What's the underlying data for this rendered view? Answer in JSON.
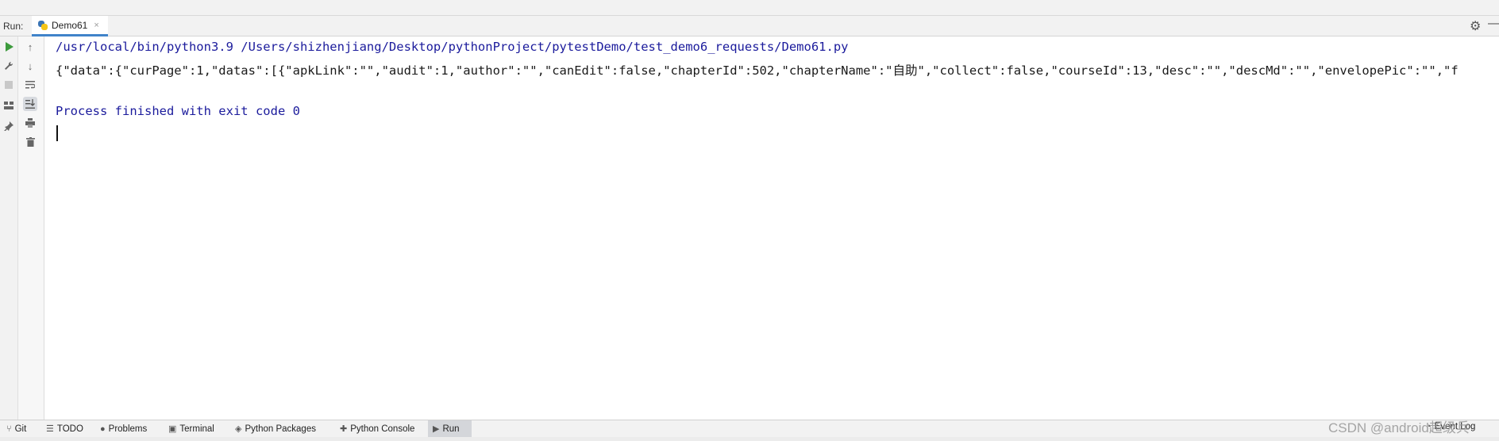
{
  "run_bar": {
    "label": "Run:",
    "tab_name": "Demo61",
    "tab_close": "×"
  },
  "console": {
    "command_line": "/usr/local/bin/python3.9 /Users/shizhenjiang/Desktop/pythonProject/pytestDemo/test_demo6_requests/Demo61.py",
    "output_line": "{\"data\":{\"curPage\":1,\"datas\":[{\"apkLink\":\"\",\"audit\":1,\"author\":\"\",\"canEdit\":false,\"chapterId\":502,\"chapterName\":\"自助\",\"collect\":false,\"courseId\":13,\"desc\":\"\",\"descMd\":\"\",\"envelopePic\":\"\",\"f",
    "finished_line": "Process finished with exit code 0"
  },
  "bottom_tabs": [
    {
      "label": "Git",
      "icon": "git-branch-icon"
    },
    {
      "label": "TODO",
      "icon": "list-icon"
    },
    {
      "label": "Problems",
      "icon": "problems-icon"
    },
    {
      "label": "Terminal",
      "icon": "terminal-icon"
    },
    {
      "label": "Python Packages",
      "icon": "packages-icon"
    },
    {
      "label": "Python Console",
      "icon": "python-console-icon"
    },
    {
      "label": "Run",
      "icon": "run-icon"
    }
  ],
  "status": {
    "event_log": "Event Log",
    "watermark": "CSDN @android超级兵"
  },
  "colors": {
    "accent": "#4083c9",
    "command_text": "#1b1b9c",
    "run_green": "#3c9a3c"
  }
}
